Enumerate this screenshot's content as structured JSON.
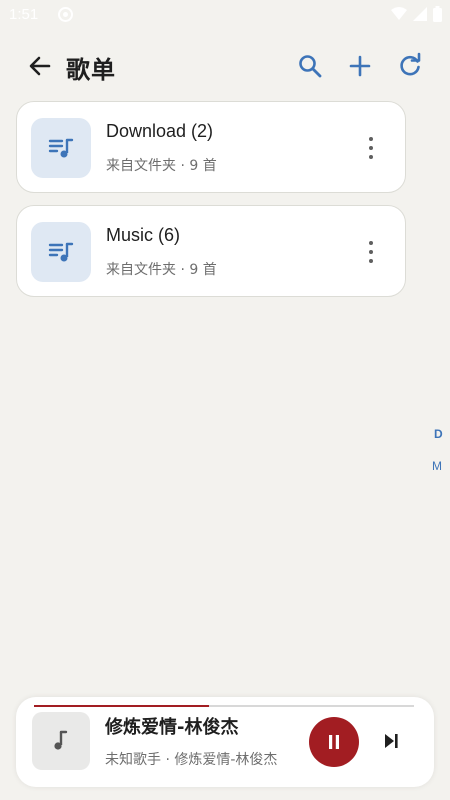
{
  "status_bar": {
    "time": "1:51",
    "icons": [
      "media-icon",
      "wifi-icon",
      "signal-icon",
      "battery-icon"
    ]
  },
  "app_bar": {
    "title": "歌单",
    "back_icon": "arrow-left-icon",
    "actions": [
      "search-icon",
      "plus-icon",
      "refresh-icon"
    ]
  },
  "playlists": [
    {
      "title": "Download (2)",
      "subtitle": "来自文件夹 · 9 首",
      "icon": "playlist-icon"
    },
    {
      "title": "Music (6)",
      "subtitle": "来自文件夹 · 9 首",
      "icon": "playlist-icon"
    }
  ],
  "index_bar": [
    "D",
    "M"
  ],
  "player": {
    "title": "修炼爱情-林俊杰",
    "subtitle": "未知歌手 · 修炼爱情-林俊杰",
    "progress": 0.46,
    "state_icon": "pause-icon",
    "next_icon": "skip-next-icon"
  },
  "colors": {
    "background": "#f3f2ee",
    "accent": "#a21d22",
    "icon_blue": "#3d74b8",
    "thumb_bg": "#dfe8f3"
  }
}
